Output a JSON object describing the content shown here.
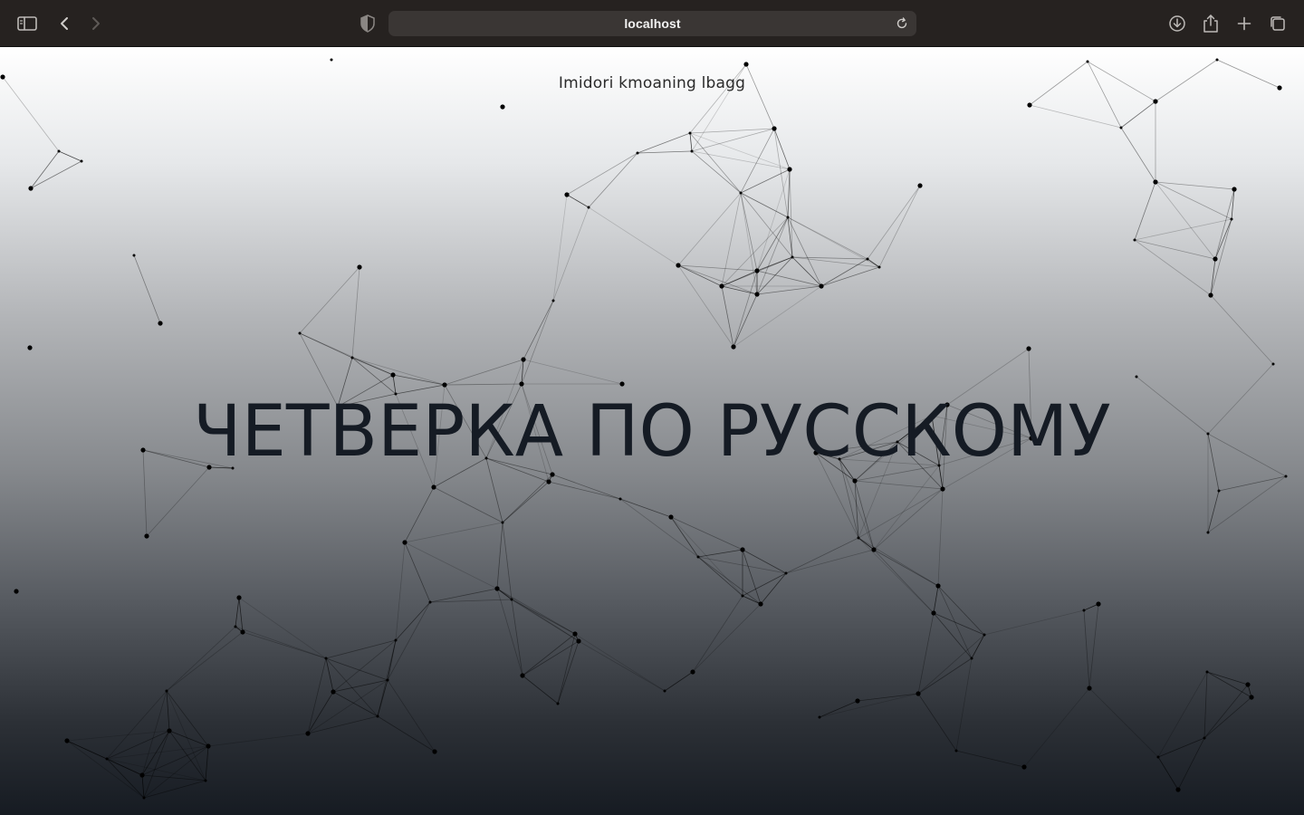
{
  "browser": {
    "address": "localhost",
    "icons": {
      "sidebar": "sidebar-toggle-icon",
      "back": "chevron-left-icon",
      "forward": "chevron-right-icon",
      "privacy": "shield-icon",
      "reload": "reload-icon",
      "download": "download-icon",
      "share": "share-icon",
      "new_tab": "plus-icon",
      "tabs": "tab-overview-icon"
    }
  },
  "page": {
    "header_text": "Imidori kmoaning lbagg",
    "title": "ЧЕТВЕРКА ПО РУССКОМУ"
  },
  "colors": {
    "gradient_top": "#ffffff",
    "gradient_bottom": "#161b22",
    "title_color": "#151b24",
    "network_color": "#000000"
  }
}
